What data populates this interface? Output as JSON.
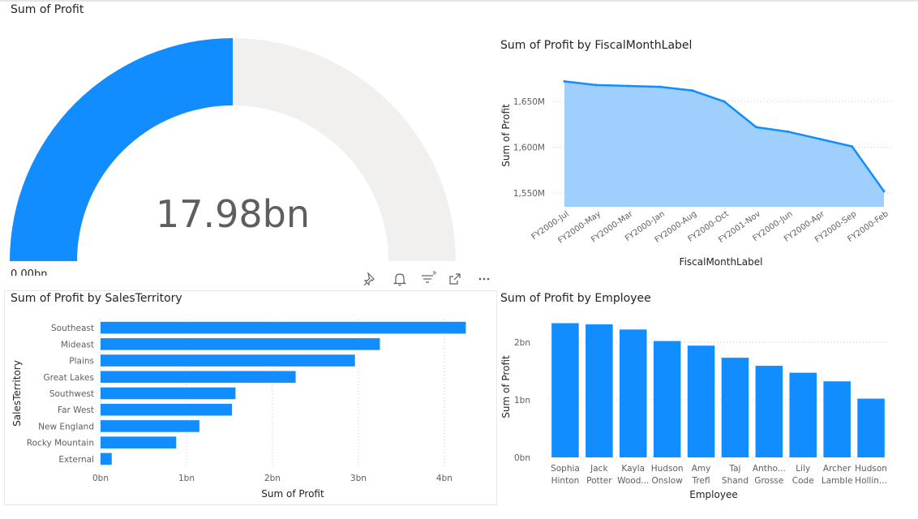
{
  "gauge": {
    "title": "Sum of Profit",
    "value_label": "17.98bn",
    "min_label": "0.00bn",
    "fraction": 0.5
  },
  "toolbar": {
    "icons": [
      "pin-icon",
      "bell-icon",
      "filter-icon",
      "expand-icon",
      "more-options-icon"
    ]
  },
  "colors": {
    "primary": "#118DFF",
    "area_fill": "#9ECFFD",
    "gauge_track": "#F1F0EF",
    "gridline": "#C8C6C4",
    "axis_text": "#605E5C"
  },
  "chart_data": [
    {
      "type": "area",
      "title": "Sum of Profit by FiscalMonthLabel",
      "xlabel": "FiscalMonthLabel",
      "ylabel": "Sum of Profit",
      "categories": [
        "FY2000-Jul",
        "FY2000-May",
        "FY2000-Mar",
        "FY2000-Jan",
        "FY2000-Aug",
        "FY2000-Oct",
        "FY2001-Nov",
        "FY2000-Jun",
        "FY2000-Apr",
        "FY2000-Sep",
        "FY2000-Feb"
      ],
      "values": [
        1672,
        1668,
        1667,
        1666,
        1662,
        1650,
        1622,
        1617,
        1609,
        1601,
        1552
      ],
      "ylim": [
        1535,
        1690
      ],
      "yticks": [
        1550,
        1600,
        1650
      ],
      "ytick_labels": [
        "1,550M",
        "1,600M",
        "1,650M"
      ],
      "grid": true
    },
    {
      "type": "bar",
      "orientation": "horizontal",
      "title": "Sum of Profit by SalesTerritory",
      "xlabel": "Sum of Profit",
      "ylabel": "SalesTerritory",
      "categories": [
        "Southeast",
        "Mideast",
        "Plains",
        "Great Lakes",
        "Southwest",
        "Far West",
        "New England",
        "Rocky Mountain",
        "External"
      ],
      "values": [
        4.25,
        3.25,
        2.96,
        2.27,
        1.57,
        1.53,
        1.15,
        0.88,
        0.13
      ],
      "xlim": [
        0,
        4.35
      ],
      "xticks": [
        0,
        1,
        2,
        3,
        4
      ],
      "xtick_labels": [
        "0bn",
        "1bn",
        "2bn",
        "3bn",
        "4bn"
      ],
      "grid": true
    },
    {
      "type": "bar",
      "title": "Sum of Profit by Employee",
      "xlabel": "Employee",
      "ylabel": "Sum of Profit",
      "categories": [
        [
          "Sophia",
          "Hinton"
        ],
        [
          "Jack",
          "Potter"
        ],
        [
          "Kayla",
          "Wood..."
        ],
        [
          "Hudson",
          "Onslow"
        ],
        [
          "Amy",
          "Trefl"
        ],
        [
          "Taj",
          "Shand"
        ],
        [
          "Antho...",
          "Grosse"
        ],
        [
          "Lily",
          "Code"
        ],
        [
          "Archer",
          "Lamble"
        ],
        [
          "Hudson",
          "Hollin..."
        ]
      ],
      "values": [
        2.33,
        2.31,
        2.22,
        2.02,
        1.94,
        1.73,
        1.59,
        1.47,
        1.32,
        1.02
      ],
      "ylim": [
        0,
        2.45
      ],
      "yticks": [
        0,
        1,
        2
      ],
      "ytick_labels": [
        "0bn",
        "1bn",
        "2bn"
      ],
      "grid": true
    }
  ]
}
